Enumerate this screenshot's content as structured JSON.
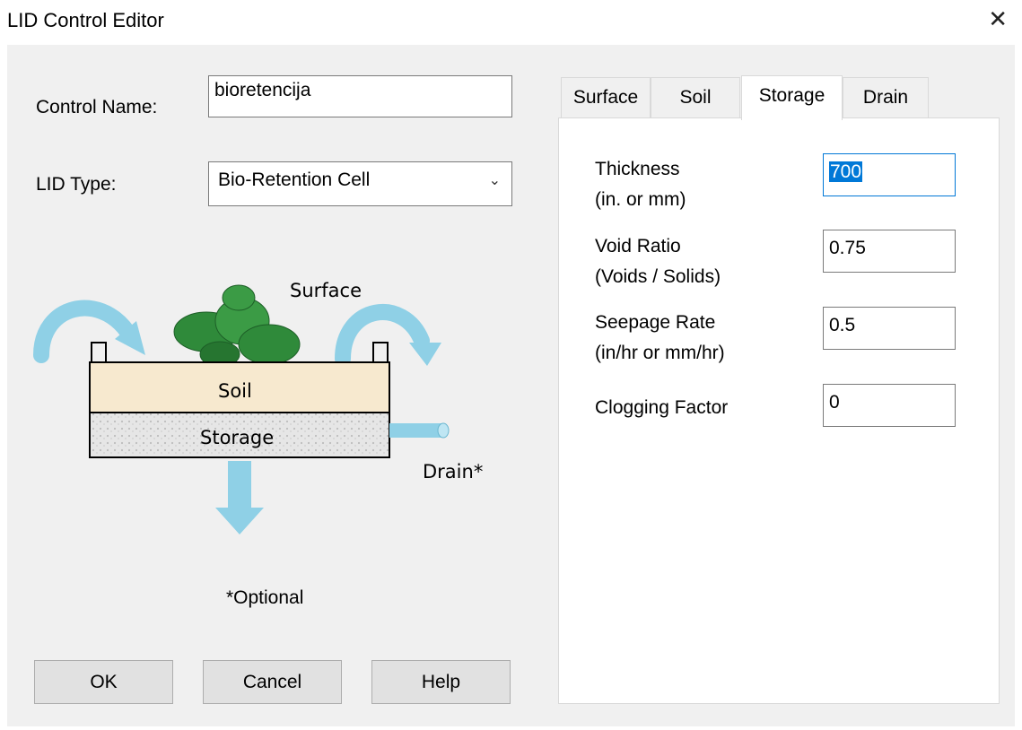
{
  "window": {
    "title": "LID Control Editor"
  },
  "form": {
    "control_name_label": "Control Name:",
    "control_name_value": "bioretencija",
    "lid_type_label": "LID Type:",
    "lid_type_value": "Bio-Retention Cell"
  },
  "diagram": {
    "surface": "Surface",
    "soil": "Soil",
    "storage": "Storage",
    "drain": "Drain*",
    "optional": "*Optional"
  },
  "buttons": {
    "ok": "OK",
    "cancel": "Cancel",
    "help": "Help"
  },
  "tabs": [
    {
      "label": "Surface"
    },
    {
      "label": "Soil"
    },
    {
      "label": "Storage"
    },
    {
      "label": "Drain"
    }
  ],
  "active_tab": "Storage",
  "storage": {
    "thickness_label": "Thickness",
    "thickness_unit": "(in. or mm)",
    "thickness_value": "700",
    "void_label": "Void Ratio",
    "void_unit": "(Voids / Solids)",
    "void_value": "0.75",
    "seepage_label": "Seepage Rate",
    "seepage_unit": "(in/hr or mm/hr)",
    "seepage_value": "0.5",
    "clogging_label": "Clogging Factor",
    "clogging_value": "0"
  },
  "colors": {
    "accent": "#0078d7",
    "arrow": "#8fd0e6",
    "soil": "#f7e9cf",
    "plant": "#2f8a3a"
  }
}
